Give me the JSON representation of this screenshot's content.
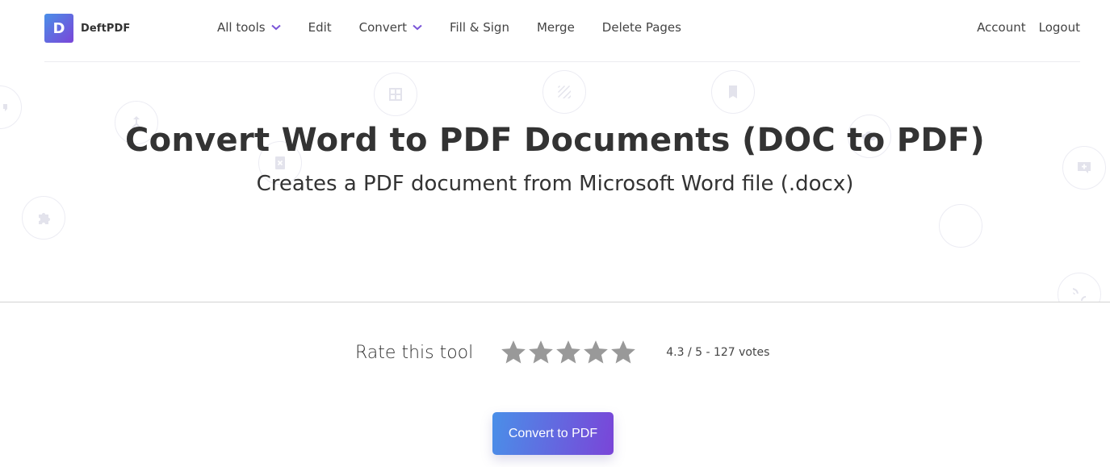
{
  "header": {
    "logo_letter": "D",
    "logo_text": "DeftPDF",
    "nav": [
      {
        "label": "All tools",
        "has_dropdown": true
      },
      {
        "label": "Edit",
        "has_dropdown": false
      },
      {
        "label": "Convert",
        "has_dropdown": true
      },
      {
        "label": "Fill & Sign",
        "has_dropdown": false
      },
      {
        "label": "Merge",
        "has_dropdown": false
      },
      {
        "label": "Delete Pages",
        "has_dropdown": false
      }
    ],
    "account_label": "Account",
    "logout_label": "Logout"
  },
  "hero": {
    "title": "Convert Word to PDF Documents (DOC to PDF)",
    "subtitle": "Creates a PDF document from Microsoft Word file (.docx)",
    "background_icons": [
      "comment-icon",
      "merge-icon",
      "delete-page-icon",
      "puzzle-icon",
      "grid-icon",
      "stripes-icon",
      "bookmark-icon",
      "cloud-icon",
      "add-comment-icon",
      "signal-icon"
    ]
  },
  "rating": {
    "label": "Rate this tool",
    "score": 4.3,
    "max": 5,
    "summary": "4.3 / 5 - 127 votes",
    "star_color": "#999999"
  },
  "action": {
    "button_label": "Convert to PDF",
    "gradient_start": "#4a8fe8",
    "gradient_end": "#7a45d8"
  }
}
